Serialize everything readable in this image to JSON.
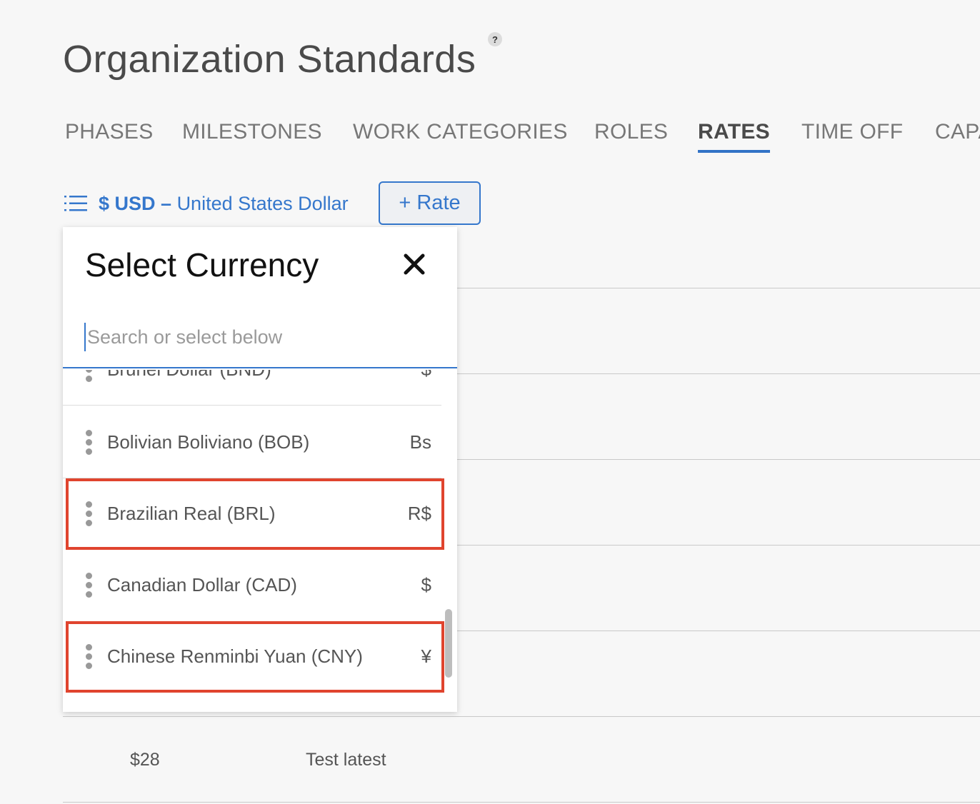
{
  "header": {
    "title": "Organization Standards",
    "help_label": "?"
  },
  "tabs": [
    {
      "label": "PHASES",
      "active": false
    },
    {
      "label": "MILESTONES",
      "active": false
    },
    {
      "label": "WORK CATEGORIES",
      "active": false
    },
    {
      "label": "ROLES",
      "active": false
    },
    {
      "label": "RATES",
      "active": true
    },
    {
      "label": "TIME OFF",
      "active": false
    },
    {
      "label": "CAPACITY",
      "active": false
    }
  ],
  "toolbar": {
    "currency_code": "$ USD",
    "currency_sep": " – ",
    "currency_name": "United States Dollar",
    "add_rate_label": "+ Rate"
  },
  "dropdown": {
    "title": "Select Currency",
    "search_placeholder": "Search or select below",
    "search_value": "",
    "items": [
      {
        "name": "Brunei Dollar (BND)",
        "symbol": "$",
        "highlighted": false
      },
      {
        "name": "Bolivian Boliviano (BOB)",
        "symbol": "Bs",
        "highlighted": false
      },
      {
        "name": "Brazilian Real (BRL)",
        "symbol": "R$",
        "highlighted": true
      },
      {
        "name": "Canadian Dollar (CAD)",
        "symbol": "$",
        "highlighted": false
      },
      {
        "name": "Chinese Renminbi Yuan (CNY)",
        "symbol": "¥",
        "highlighted": true
      }
    ]
  },
  "table": {
    "visible_row": {
      "rate": "$28",
      "description": "Test latest"
    }
  },
  "colors": {
    "accent": "#3577cc",
    "highlight_border": "#e0442e",
    "text": "#555555"
  }
}
